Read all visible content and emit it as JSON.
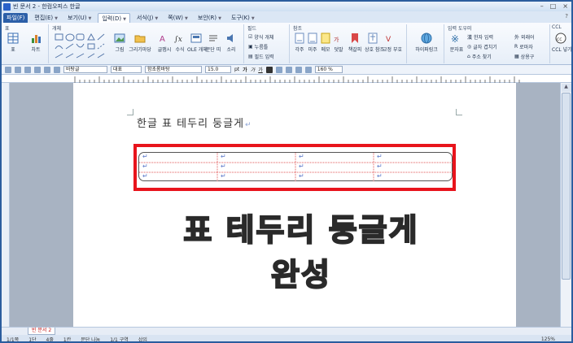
{
  "window": {
    "title": "빈 문서 2 - 한컴오피스 한글",
    "controls": [
      "–",
      "□",
      "×"
    ]
  },
  "menubar": {
    "items": [
      "파일(F)",
      "편집(E)",
      "보기(U)",
      "입력(D)",
      "서식(J)",
      "쪽(W)",
      "보안(R)",
      "도구(K)"
    ],
    "active_index": 3
  },
  "ribbon": {
    "groups": {
      "table": "표",
      "object": "개체",
      "field": "필드",
      "reference": "참조",
      "input_tool": "입력 도우미",
      "ccl": "CCL"
    },
    "buttons": {
      "table": "표",
      "chart": "차트",
      "picture": "그림",
      "draw_object": "그리기마당",
      "glyph": "글맵시",
      "formula": "수식",
      "ole": "OLE 개체",
      "paragraph": "문단 띠",
      "sound": "소리",
      "form_object": "양식 개체",
      "click_here": "누름틀",
      "field_input": "필드 입력",
      "footnote": "각주",
      "endnote": "미주",
      "memo": "메모",
      "annotation": "덧말",
      "bookmark": "책갈피",
      "cross_ref": "상호 참조",
      "check_fix": "교정 부호",
      "hyperlink": "하이퍼링크",
      "char_table": "문자표",
      "hanja_input": "한자 입력",
      "char_overlap": "글자 겹치기",
      "address": "주소 찾기",
      "foreign": "외래어",
      "romaja": "로마자",
      "product": "상용구",
      "ccl_insert": "CCL 넣기"
    }
  },
  "toolbar2": {
    "style": "바탕글",
    "lang": "대표",
    "font": "함초롬바탕",
    "size": "15.0",
    "unit": "pt",
    "bold": "가",
    "italic": "가",
    "underline": "가",
    "zoom": "160 %"
  },
  "document": {
    "heading": "한글 표 테두리 둥글게",
    "para_mark": "↵",
    "rows": 3,
    "cols": 4
  },
  "caption": "표 테두리 둥글게 완성",
  "tabs": {
    "doc_tab": "빈 문서 2"
  },
  "status": {
    "items": [
      "1/1쪽",
      "1단",
      "4줄",
      "1칸",
      "문단 나눔",
      "1/1 구역",
      "삽입"
    ],
    "zoom": "125%"
  },
  "colors": {
    "highlight": "#e8141c",
    "caption_fill": "#f3c21a",
    "chrome_blue": "#2b5d9e"
  }
}
